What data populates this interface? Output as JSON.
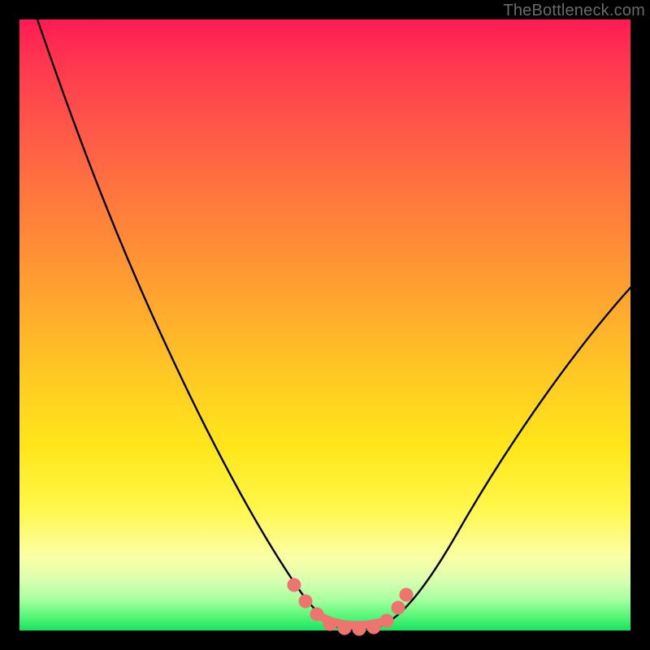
{
  "watermark": "TheBottleneck.com",
  "chart_data": {
    "type": "line",
    "title": "",
    "xlabel": "",
    "ylabel": "",
    "xlim": [
      0,
      100
    ],
    "ylim": [
      0,
      100
    ],
    "grid": false,
    "background_gradient": {
      "direction": "top-to-bottom",
      "top": "#ff1a55",
      "bottom": "#18e45d"
    },
    "series": [
      {
        "name": "bottleneck-curve",
        "color": "#000000",
        "x": [
          3,
          10,
          20,
          30,
          38,
          44,
          48,
          50,
          52,
          54,
          56,
          58,
          60,
          63,
          70,
          80,
          90,
          100
        ],
        "values": [
          100,
          84,
          66,
          47,
          31,
          19,
          9,
          4,
          1,
          0,
          0,
          1,
          3,
          7,
          17,
          31,
          44,
          56
        ]
      }
    ],
    "markers": {
      "name": "highlight-dots",
      "color": "#ef746f",
      "x": [
        44,
        46,
        48,
        50,
        52,
        54,
        56,
        58,
        60,
        62
      ],
      "values": [
        12,
        8,
        5,
        2,
        1,
        0,
        0,
        1,
        3,
        7
      ]
    }
  }
}
